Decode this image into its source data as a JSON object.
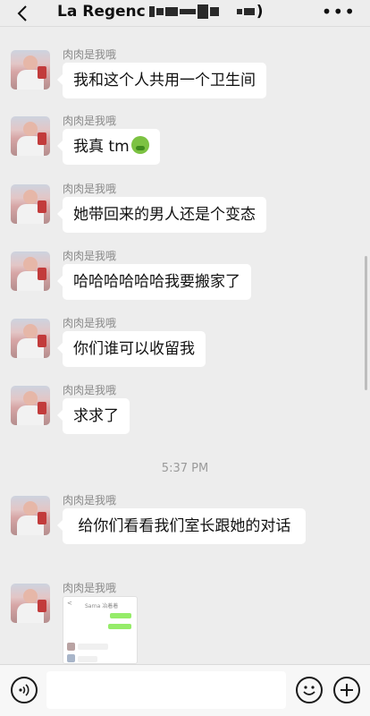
{
  "header": {
    "title": "La Regenc",
    "title_suffix": ")",
    "more_label": "•••"
  },
  "messages": [
    {
      "nickname": "肉肉是我哦",
      "text": "我和这个人共用一个卫生间"
    },
    {
      "nickname": "肉肉是我哦",
      "text": "我真 tm",
      "emoji": "nauseated-face-icon"
    },
    {
      "nickname": "肉肉是我哦",
      "text": "她带回来的男人还是个变态"
    },
    {
      "nickname": "肉肉是我哦",
      "text": "哈哈哈哈哈哈我要搬家了"
    },
    {
      "nickname": "肉肉是我哦",
      "text": "你们谁可以收留我"
    },
    {
      "nickname": "肉肉是我哦",
      "text": "求求了"
    },
    {
      "nickname": "肉肉是我哦",
      "text": " 给你们看看我们室长跟她的对话"
    },
    {
      "nickname": "肉肉是我哦",
      "image": "chat-screenshot-thumbnail"
    }
  ],
  "timestamp": "5:37 PM",
  "thumbnail": {
    "title": "Sarna 冶着着",
    "back": "<"
  },
  "footer": {
    "input_placeholder": ""
  },
  "colors": {
    "background": "#ededed",
    "bubble": "#ffffff",
    "wechat_green": "#95ec69"
  }
}
